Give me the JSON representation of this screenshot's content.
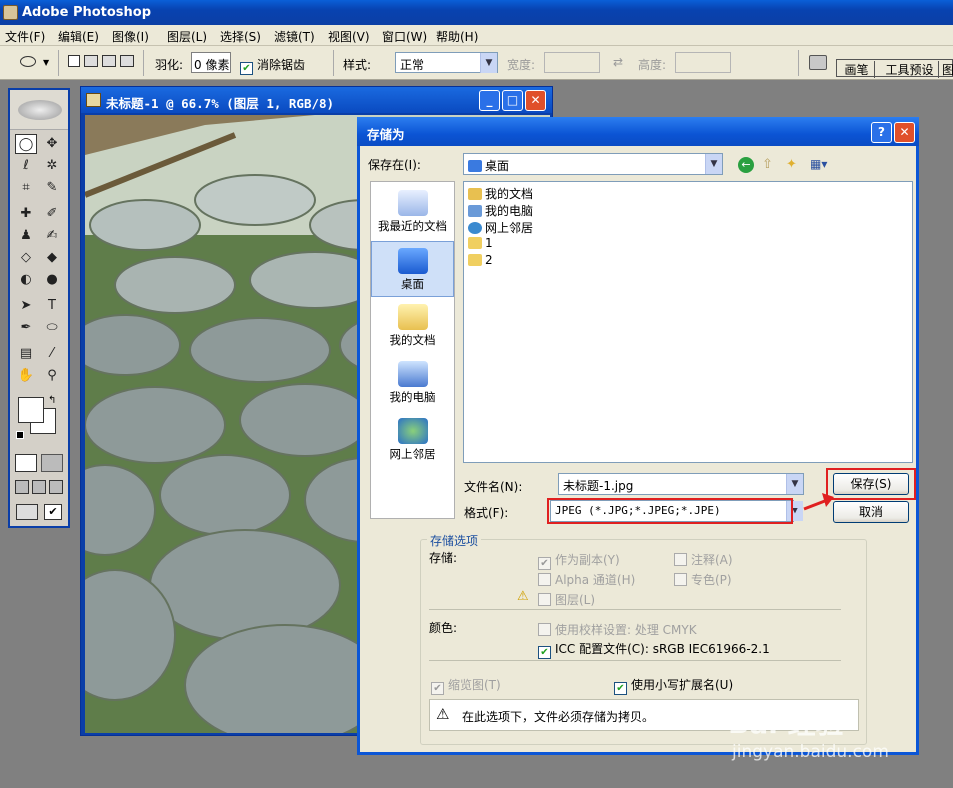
{
  "app": {
    "title": "Adobe Photoshop"
  },
  "menubar": [
    "文件(F)",
    "编辑(E)",
    "图像(I)",
    "图层(L)",
    "选择(S)",
    "滤镜(T)",
    "视图(V)",
    "窗口(W)",
    "帮助(H)"
  ],
  "options": {
    "feather_label": "羽化:",
    "feather_value": "0 像素",
    "antialias_label": "消除锯齿",
    "style_label": "样式:",
    "style_value": "正常",
    "width_label": "宽度:",
    "height_label": "高度:",
    "tab_brushes": "画笔",
    "tab_presets": "工具预设",
    "tab_extra": "图"
  },
  "document": {
    "title": "未标题-1 @ 66.7% (图层 1, RGB/8)"
  },
  "dialog": {
    "title": "存储为",
    "save_in_label": "保存在(I):",
    "save_in_value": "桌面",
    "places": [
      "我最近的文档",
      "桌面",
      "我的文档",
      "我的电脑",
      "网上邻居"
    ],
    "files": [
      "我的文档",
      "我的电脑",
      "网上邻居",
      "1",
      "2"
    ],
    "filename_label": "文件名(N):",
    "filename_value": "未标题-1.jpg",
    "format_label": "格式(F):",
    "format_value": "JPEG (*.JPG;*.JPEG;*.JPE)",
    "save_button": "保存(S)",
    "cancel_button": "取消",
    "options_group": "存储选项",
    "store_label": "存储:",
    "as_copy": "作为副本(Y)",
    "annotations": "注释(A)",
    "alpha": "Alpha 通道(H)",
    "spot": "专色(P)",
    "layers": "图层(L)",
    "color_label": "颜色:",
    "proof": "使用校样设置: 处理 CMYK",
    "icc": "ICC 配置文件(C): sRGB IEC61966-2.1",
    "thumbnail": "缩览图(T)",
    "lowercase_ext": "使用小写扩展名(U)",
    "warning": "在此选项下，文件必须存储为拷贝。"
  },
  "watermark": {
    "text": "Bai 经验",
    "sub": "jingyan.baidu.com"
  }
}
